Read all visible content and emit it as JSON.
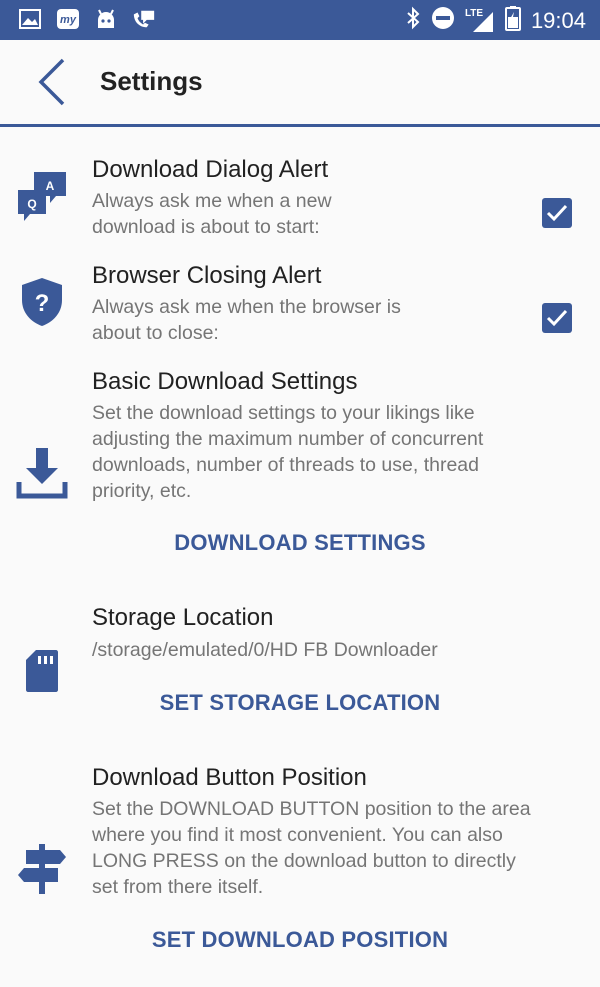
{
  "status_bar": {
    "network_label": "LTE",
    "time": "19:04"
  },
  "header": {
    "title": "Settings"
  },
  "settings": {
    "download_dialog": {
      "title": "Download Dialog Alert",
      "desc_line1": "Always ask me when a new",
      "desc_line2": "download is about to start:",
      "checked": true,
      "icon_badge_a": "A",
      "icon_badge_q": "Q"
    },
    "browser_closing": {
      "title": "Browser Closing Alert",
      "desc_line1": "Always ask me when the browser is",
      "desc_line2": "about to close:",
      "checked": true,
      "icon_symbol": "?"
    },
    "basic_download": {
      "title": "Basic Download Settings",
      "desc_line1": "Set the download settings to your likings like",
      "desc_line2": "adjusting the maximum number of concurrent",
      "desc_line3": "downloads, number of threads to use, thread",
      "desc_line4": "priority, etc.",
      "action_label": "DOWNLOAD SETTINGS"
    },
    "storage": {
      "title": "Storage Location",
      "path": "/storage/emulated/0/HD FB Downloader",
      "action_label": "SET STORAGE LOCATION"
    },
    "button_position": {
      "title": "Download Button Position",
      "desc_line1": "Set the DOWNLOAD BUTTON position to the area",
      "desc_line2": "where you find it most convenient. You can also",
      "desc_line3": "LONG PRESS on the download button to directly",
      "desc_line4": "set from there itself.",
      "action_label": "SET DOWNLOAD POSITION"
    }
  },
  "colors": {
    "accent": "#3b5998",
    "title_text": "#212121",
    "secondary_text": "#757575",
    "background": "#fafafa"
  }
}
